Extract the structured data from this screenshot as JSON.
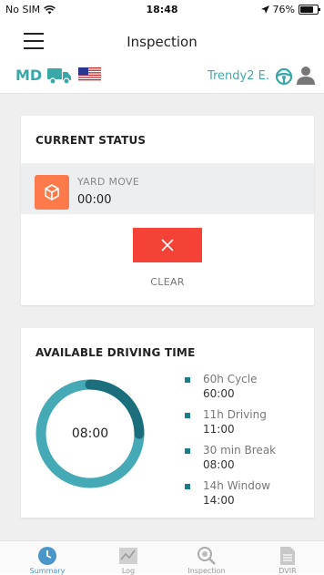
{
  "status_bar": {
    "carrier": "No SIM",
    "time": "18:48",
    "battery": "76%",
    "battery_level": 0.76
  },
  "header": {
    "title": "Inspection"
  },
  "subheader": {
    "mode": "MD",
    "driver": "Trendy2 E."
  },
  "current_status": {
    "title": "CURRENT STATUS",
    "status_label": "YARD MOVE",
    "status_time": "00:00",
    "clear_label": "CLEAR"
  },
  "driving_time": {
    "title": "AVAILABLE DRIVING TIME",
    "center_value": "08:00",
    "ring_fraction": 0.25,
    "ring_colors": {
      "done": "#1b6f7c",
      "remaining": "#45a9b6"
    },
    "items": [
      {
        "name": "60h Cycle",
        "value": "60:00"
      },
      {
        "name": "11h Driving",
        "value": "11:00"
      },
      {
        "name": "30 min Break",
        "value": "08:00"
      },
      {
        "name": "14h Window",
        "value": "14:00"
      }
    ]
  },
  "tabs": [
    {
      "label": "Summary",
      "icon": "clock-icon",
      "active": true
    },
    {
      "label": "Log",
      "icon": "graph-icon",
      "active": false
    },
    {
      "label": "Inspection",
      "icon": "magnifier-icon",
      "active": false
    },
    {
      "label": "DVIR",
      "icon": "document-icon",
      "active": false
    }
  ],
  "colors": {
    "accent": "#3aa7a8",
    "status_orange": "#ff7a4a",
    "clear_red": "#f44336",
    "ring_dark": "#1b6f7c",
    "ring_light": "#45a9b6"
  }
}
